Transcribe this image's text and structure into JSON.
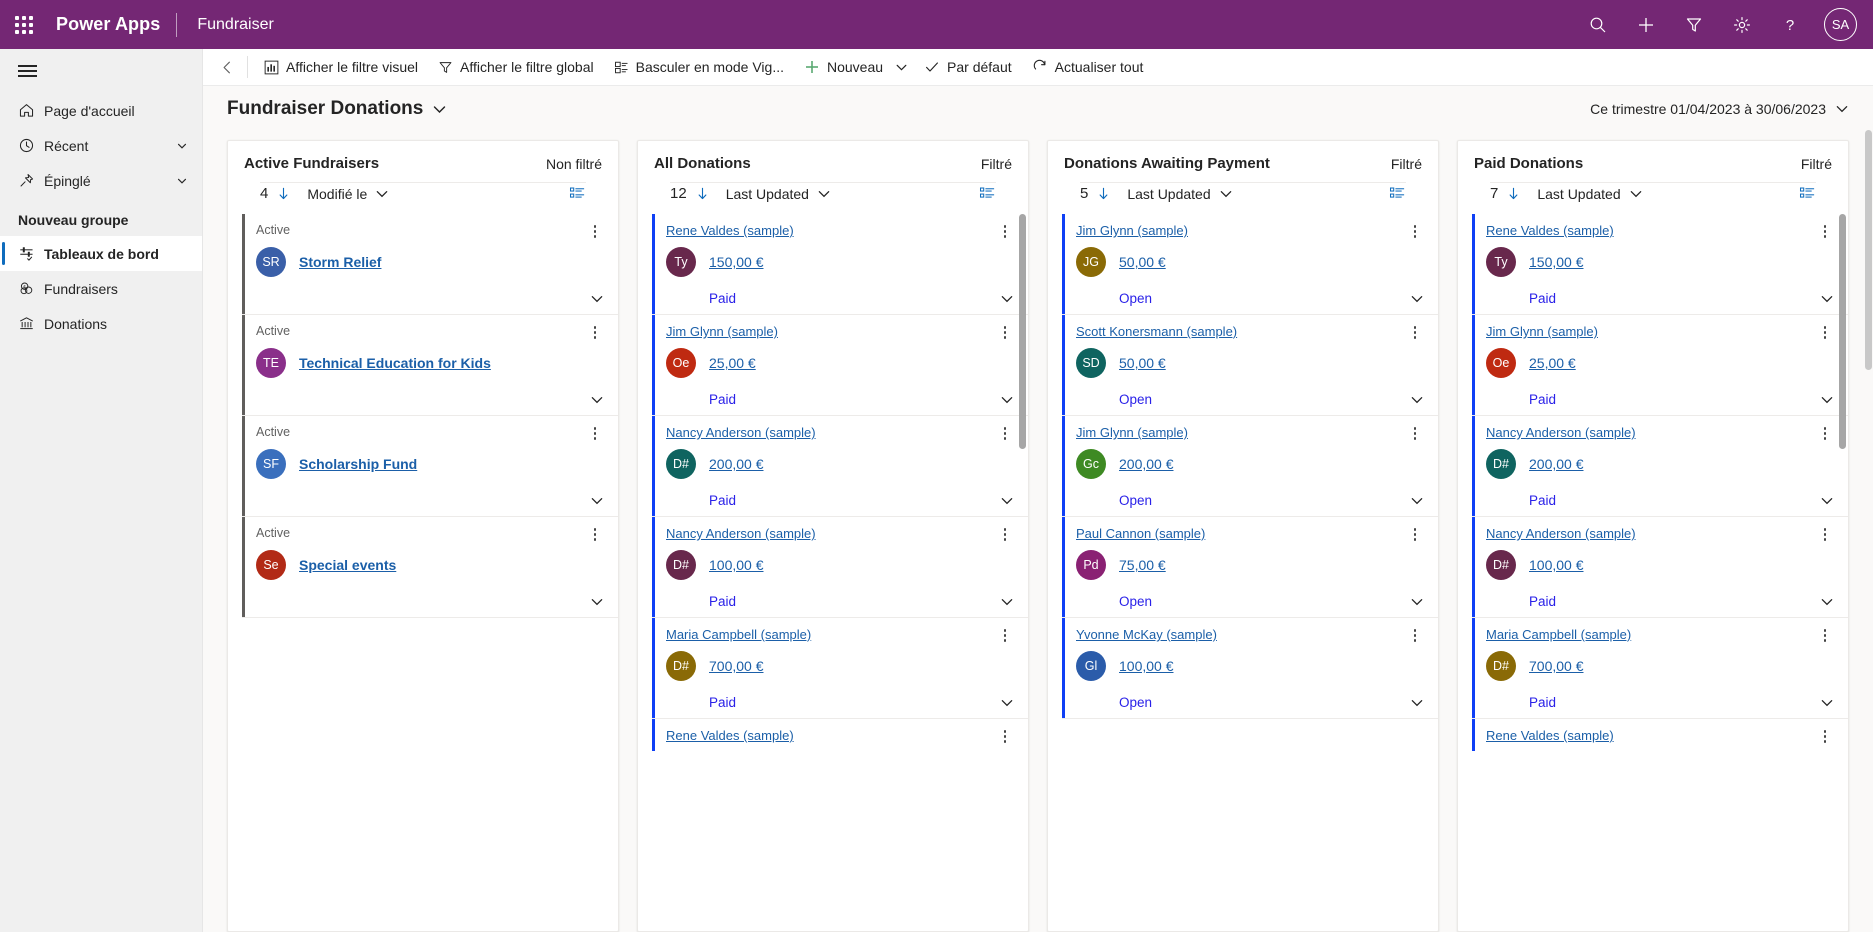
{
  "topbar": {
    "waffle_label": "app-launcher",
    "brand": "Power Apps",
    "app_name": "Fundraiser",
    "icons": [
      "search-icon",
      "plus-icon",
      "filter-icon",
      "gear-icon",
      "help-icon"
    ],
    "avatar_initials": "SA",
    "bg_color": "#742774"
  },
  "sidebar": {
    "hamburger_label": "Menu",
    "items": [
      {
        "label": "Page d'accueil",
        "icon": "home-icon",
        "chevron": false,
        "selected": false
      },
      {
        "label": "Récent",
        "icon": "clock-icon",
        "chevron": true,
        "selected": false
      },
      {
        "label": "Épinglé",
        "icon": "pin-icon",
        "chevron": true,
        "selected": false
      }
    ],
    "group_label": "Nouveau groupe",
    "group_items": [
      {
        "label": "Tableaux de bord",
        "icon": "dashboard-icon",
        "selected": true
      },
      {
        "label": "Fundraisers",
        "icon": "money-icon",
        "selected": false
      },
      {
        "label": "Donations",
        "icon": "bank-icon",
        "selected": false
      }
    ]
  },
  "commandbar": {
    "back_label": "Retour",
    "buttons": [
      {
        "label": "Afficher le filtre visuel",
        "icon": "chart-icon",
        "caret": false
      },
      {
        "label": "Afficher le filtre global",
        "icon": "funnel-icon",
        "caret": false
      },
      {
        "label": "Basculer en mode Vig...",
        "icon": "tiles-icon",
        "caret": false
      },
      {
        "label": "Nouveau",
        "icon": "plus-icon",
        "caret": true
      },
      {
        "label": "Par défaut",
        "icon": "check-icon",
        "caret": false
      },
      {
        "label": "Actualiser tout",
        "icon": "refresh-icon",
        "caret": false
      }
    ]
  },
  "page": {
    "title": "Fundraiser Donations",
    "title_caret": "chevron-down-icon",
    "date_range": "Ce trimestre 01/04/2023 à 30/06/2023"
  },
  "streams": [
    {
      "title": "Active Fundraisers",
      "filter_state": "Non filtré",
      "count": "4",
      "sort": "Modifié le",
      "accent": "grey",
      "cards": [
        {
          "status": "Active",
          "name": "Storm Relief",
          "initials": "SR",
          "avatar_color": "#3a5fa8",
          "state": "",
          "type": "fundraiser"
        },
        {
          "status": "Active",
          "name": "Technical Education for Kids",
          "initials": "TE",
          "avatar_color": "#8a2f8a",
          "state": "",
          "type": "fundraiser"
        },
        {
          "status": "Active",
          "name": "Scholarship Fund",
          "initials": "SF",
          "avatar_color": "#3a6fbd",
          "state": "",
          "type": "fundraiser"
        },
        {
          "status": "Active",
          "name": "Special events",
          "initials": "Se",
          "avatar_color": "#b22a16",
          "state": "",
          "type": "fundraiser"
        }
      ]
    },
    {
      "title": "All Donations",
      "filter_state": "Filtré",
      "count": "12",
      "sort": "Last Updated",
      "accent": "blue",
      "scroll": true,
      "cards": [
        {
          "status": "Rene Valdes (sample)",
          "amount": "150,00 €",
          "initials": "Ty",
          "avatar_color": "#68284c",
          "state": "Paid",
          "type": "donation"
        },
        {
          "status": "Jim Glynn (sample)",
          "amount": "25,00 €",
          "initials": "Oe",
          "avatar_color": "#bf2a11",
          "state": "Paid",
          "type": "donation"
        },
        {
          "status": "Nancy Anderson (sample)",
          "amount": "200,00 €",
          "initials": "D#",
          "avatar_color": "#0f6460",
          "state": "Paid",
          "type": "donation"
        },
        {
          "status": "Nancy Anderson (sample)",
          "amount": "100,00 €",
          "initials": "D#",
          "avatar_color": "#68284c",
          "state": "Paid",
          "type": "donation"
        },
        {
          "status": "Maria Campbell (sample)",
          "amount": "700,00 €",
          "initials": "D#",
          "avatar_color": "#8a6a06",
          "state": "Paid",
          "type": "donation"
        },
        {
          "status": "Rene Valdes (sample)",
          "amount": "",
          "initials": "",
          "avatar_color": "",
          "state": "",
          "type": "donation-partial"
        }
      ]
    },
    {
      "title": "Donations Awaiting Payment",
      "filter_state": "Filtré",
      "count": "5",
      "sort": "Last Updated",
      "accent": "blue",
      "cards": [
        {
          "status": "Jim Glynn (sample)",
          "amount": "50,00 €",
          "initials": "JG",
          "avatar_color": "#8a6a06",
          "state": "Open",
          "type": "donation"
        },
        {
          "status": "Scott Konersmann (sample)",
          "amount": "50,00 €",
          "initials": "SD",
          "avatar_color": "#0f6460",
          "state": "Open",
          "type": "donation"
        },
        {
          "status": "Jim Glynn (sample)",
          "amount": "200,00 €",
          "initials": "Gc",
          "avatar_color": "#3e8a23",
          "state": "Open",
          "type": "donation"
        },
        {
          "status": "Paul Cannon (sample)",
          "amount": "75,00 €",
          "initials": "Pd",
          "avatar_color": "#8a2173",
          "state": "Open",
          "type": "donation"
        },
        {
          "status": "Yvonne McKay (sample)",
          "amount": "100,00 €",
          "initials": "Gl",
          "avatar_color": "#2b5caa",
          "state": "Open",
          "type": "donation"
        }
      ]
    },
    {
      "title": "Paid Donations",
      "filter_state": "Filtré",
      "count": "7",
      "sort": "Last Updated",
      "accent": "blue",
      "scroll": true,
      "cards": [
        {
          "status": "Rene Valdes (sample)",
          "amount": "150,00 €",
          "initials": "Ty",
          "avatar_color": "#68284c",
          "state": "Paid",
          "type": "donation"
        },
        {
          "status": "Jim Glynn (sample)",
          "amount": "25,00 €",
          "initials": "Oe",
          "avatar_color": "#bf2a11",
          "state": "Paid",
          "type": "donation"
        },
        {
          "status": "Nancy Anderson (sample)",
          "amount": "200,00 €",
          "initials": "D#",
          "avatar_color": "#0f6460",
          "state": "Paid",
          "type": "donation"
        },
        {
          "status": "Nancy Anderson (sample)",
          "amount": "100,00 €",
          "initials": "D#",
          "avatar_color": "#68284c",
          "state": "Paid",
          "type": "donation"
        },
        {
          "status": "Maria Campbell (sample)",
          "amount": "700,00 €",
          "initials": "D#",
          "avatar_color": "#8a6a06",
          "state": "Paid",
          "type": "donation"
        },
        {
          "status": "Rene Valdes (sample)",
          "amount": "",
          "initials": "",
          "avatar_color": "",
          "state": "",
          "type": "donation-partial"
        }
      ]
    }
  ]
}
